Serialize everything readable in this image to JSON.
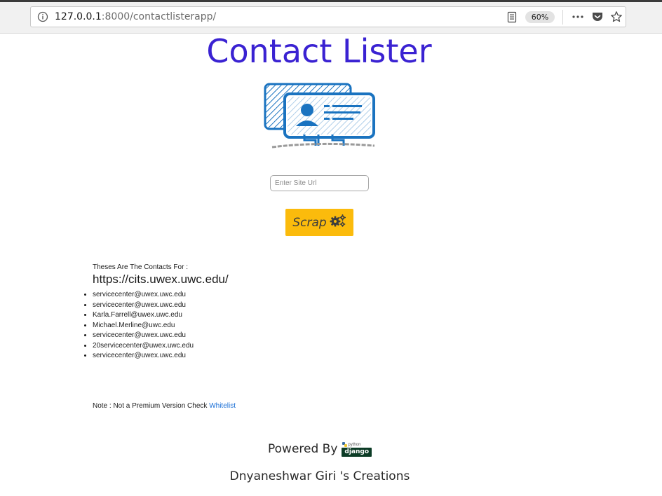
{
  "browser": {
    "url_host": "127.0.0.1",
    "url_rest": ":8000/contactlisterapp/",
    "zoom": "60%"
  },
  "page": {
    "title": "Contact Lister",
    "search": {
      "placeholder": "Enter Site Url"
    },
    "scrap_button_label": "Scrap",
    "results_heading": "Theses Are The Contacts For :",
    "results_url": "https://cits.uwex.uwc.edu/",
    "contacts": [
      "servicecenter@uwex.uwc.edu",
      "servicecenter@uwex.uwc.edu",
      "Karla.Farrell@uwex.uwc.edu",
      "Michael.Merline@uwc.edu",
      "servicecenter@uwex.uwc.edu",
      "20servicecenter@uwex.uwc.edu",
      "servicecenter@uwex.uwc.edu"
    ],
    "note_text": "Note : Not a Premium Version Check ",
    "note_link": "Whitelist",
    "powered_by": "Powered By",
    "django_logo": {
      "python_text": "python",
      "django_text": "django"
    },
    "credit": "Dnyaneshwar Giri 's Creations"
  },
  "colors": {
    "title": "#3a22d2",
    "button": "#fbbb0c",
    "logo": "#1a73c0",
    "link": "#1a6fd6",
    "django_box": "#0c3c26"
  },
  "icons": {
    "info": "info-icon",
    "reader": "reader-view-icon",
    "overflow": "more-dots-icon",
    "pocket": "pocket-icon",
    "bookmark": "star-icon",
    "scrap": "gears-icon",
    "logo": "contact-card-icon"
  }
}
